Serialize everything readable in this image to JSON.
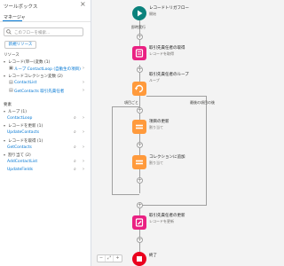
{
  "toolbox": {
    "title": "ツールボックス",
    "close_icon": "close-icon",
    "tab_label": "マネージャ",
    "search_placeholder": "このフローを検索...",
    "new_resource_label": "新規リソース",
    "sections": {
      "variables": "リソース",
      "record_var_heading": "レコード(単一)変数 (1)",
      "record_var_item": "ループ ContactLoop (自動生の項目)",
      "collection_heading": "レコードコレクション変数 (2)",
      "collection_items": [
        "ContactList",
        "GetContacts 取引先責任者"
      ],
      "elements": "要素",
      "loop_heading": "ループ (1)",
      "loop_item": "ContactLoop",
      "update_heading": "レコードを更新 (1)",
      "update_item": "UpdateContacts",
      "get_heading": "レコードを取得 (1)",
      "get_item": "GetContacts",
      "assign_heading": "割り当て (2)",
      "assign_items": [
        "AddContactList",
        "UpdateFields"
      ]
    }
  },
  "canvas": {
    "start_label": "レコードトリガフロー",
    "start_sub": "開始",
    "edge_run_immediately": "即時実行",
    "node_get_label": "取引先責任者の取得",
    "node_get_sub": "レコードを取得",
    "node_loop_label": "取引先責任者のループ",
    "node_loop_sub": "ループ",
    "edge_for_each": "項目ごと",
    "edge_after_last": "最後の項目の後",
    "node_assign1_label": "項目の更新",
    "node_assign1_sub": "割り当て",
    "node_assign2_label": "コレクションに追加",
    "node_assign2_sub": "割り当て",
    "node_update_label": "取引先責任者の更新",
    "node_update_sub": "レコードを更新",
    "end_label": "終了",
    "zoom_controls": [
      "−",
      "⤢",
      "+"
    ]
  },
  "colors": {
    "start": "#0b827c",
    "record": "#ea2082",
    "loop": "#ff9a3c",
    "end": "#ea001e",
    "accent": "#0176d3"
  }
}
